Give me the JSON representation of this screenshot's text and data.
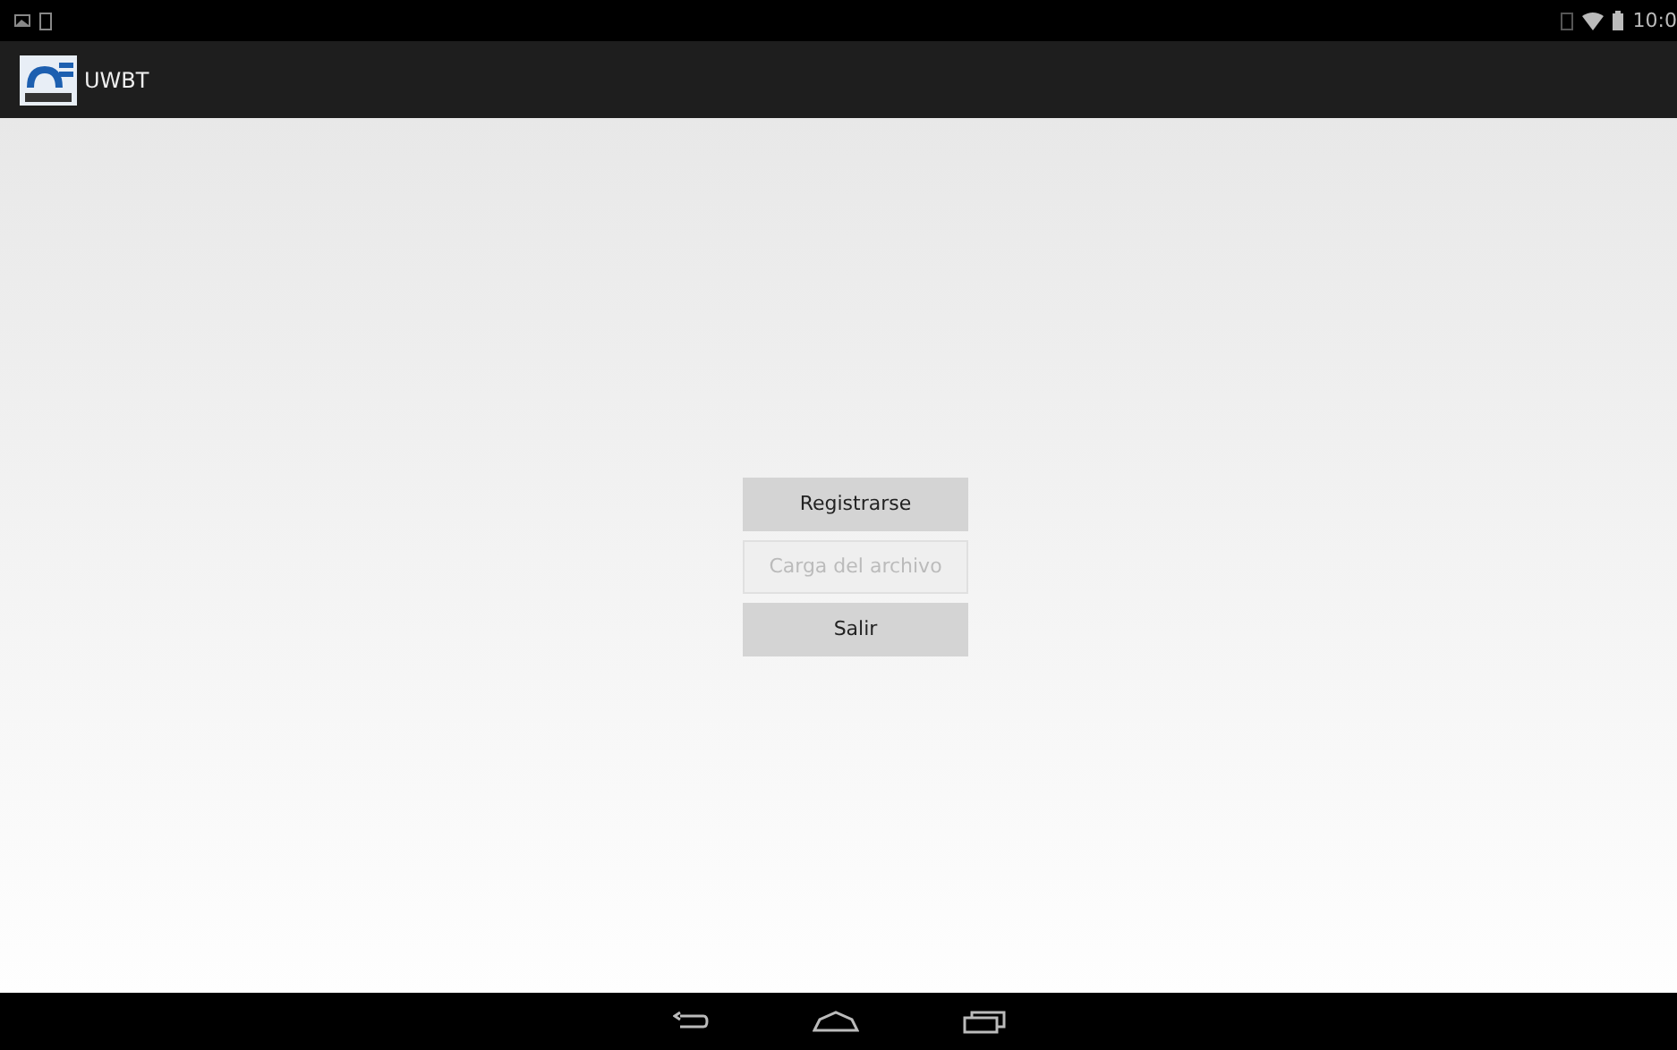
{
  "status_bar": {
    "time": "10:0"
  },
  "action_bar": {
    "title": "UWBT"
  },
  "buttons": [
    {
      "label": "Registrarse",
      "disabled": false
    },
    {
      "label": "Carga del archivo",
      "disabled": true
    },
    {
      "label": "Salir",
      "disabled": false
    }
  ]
}
